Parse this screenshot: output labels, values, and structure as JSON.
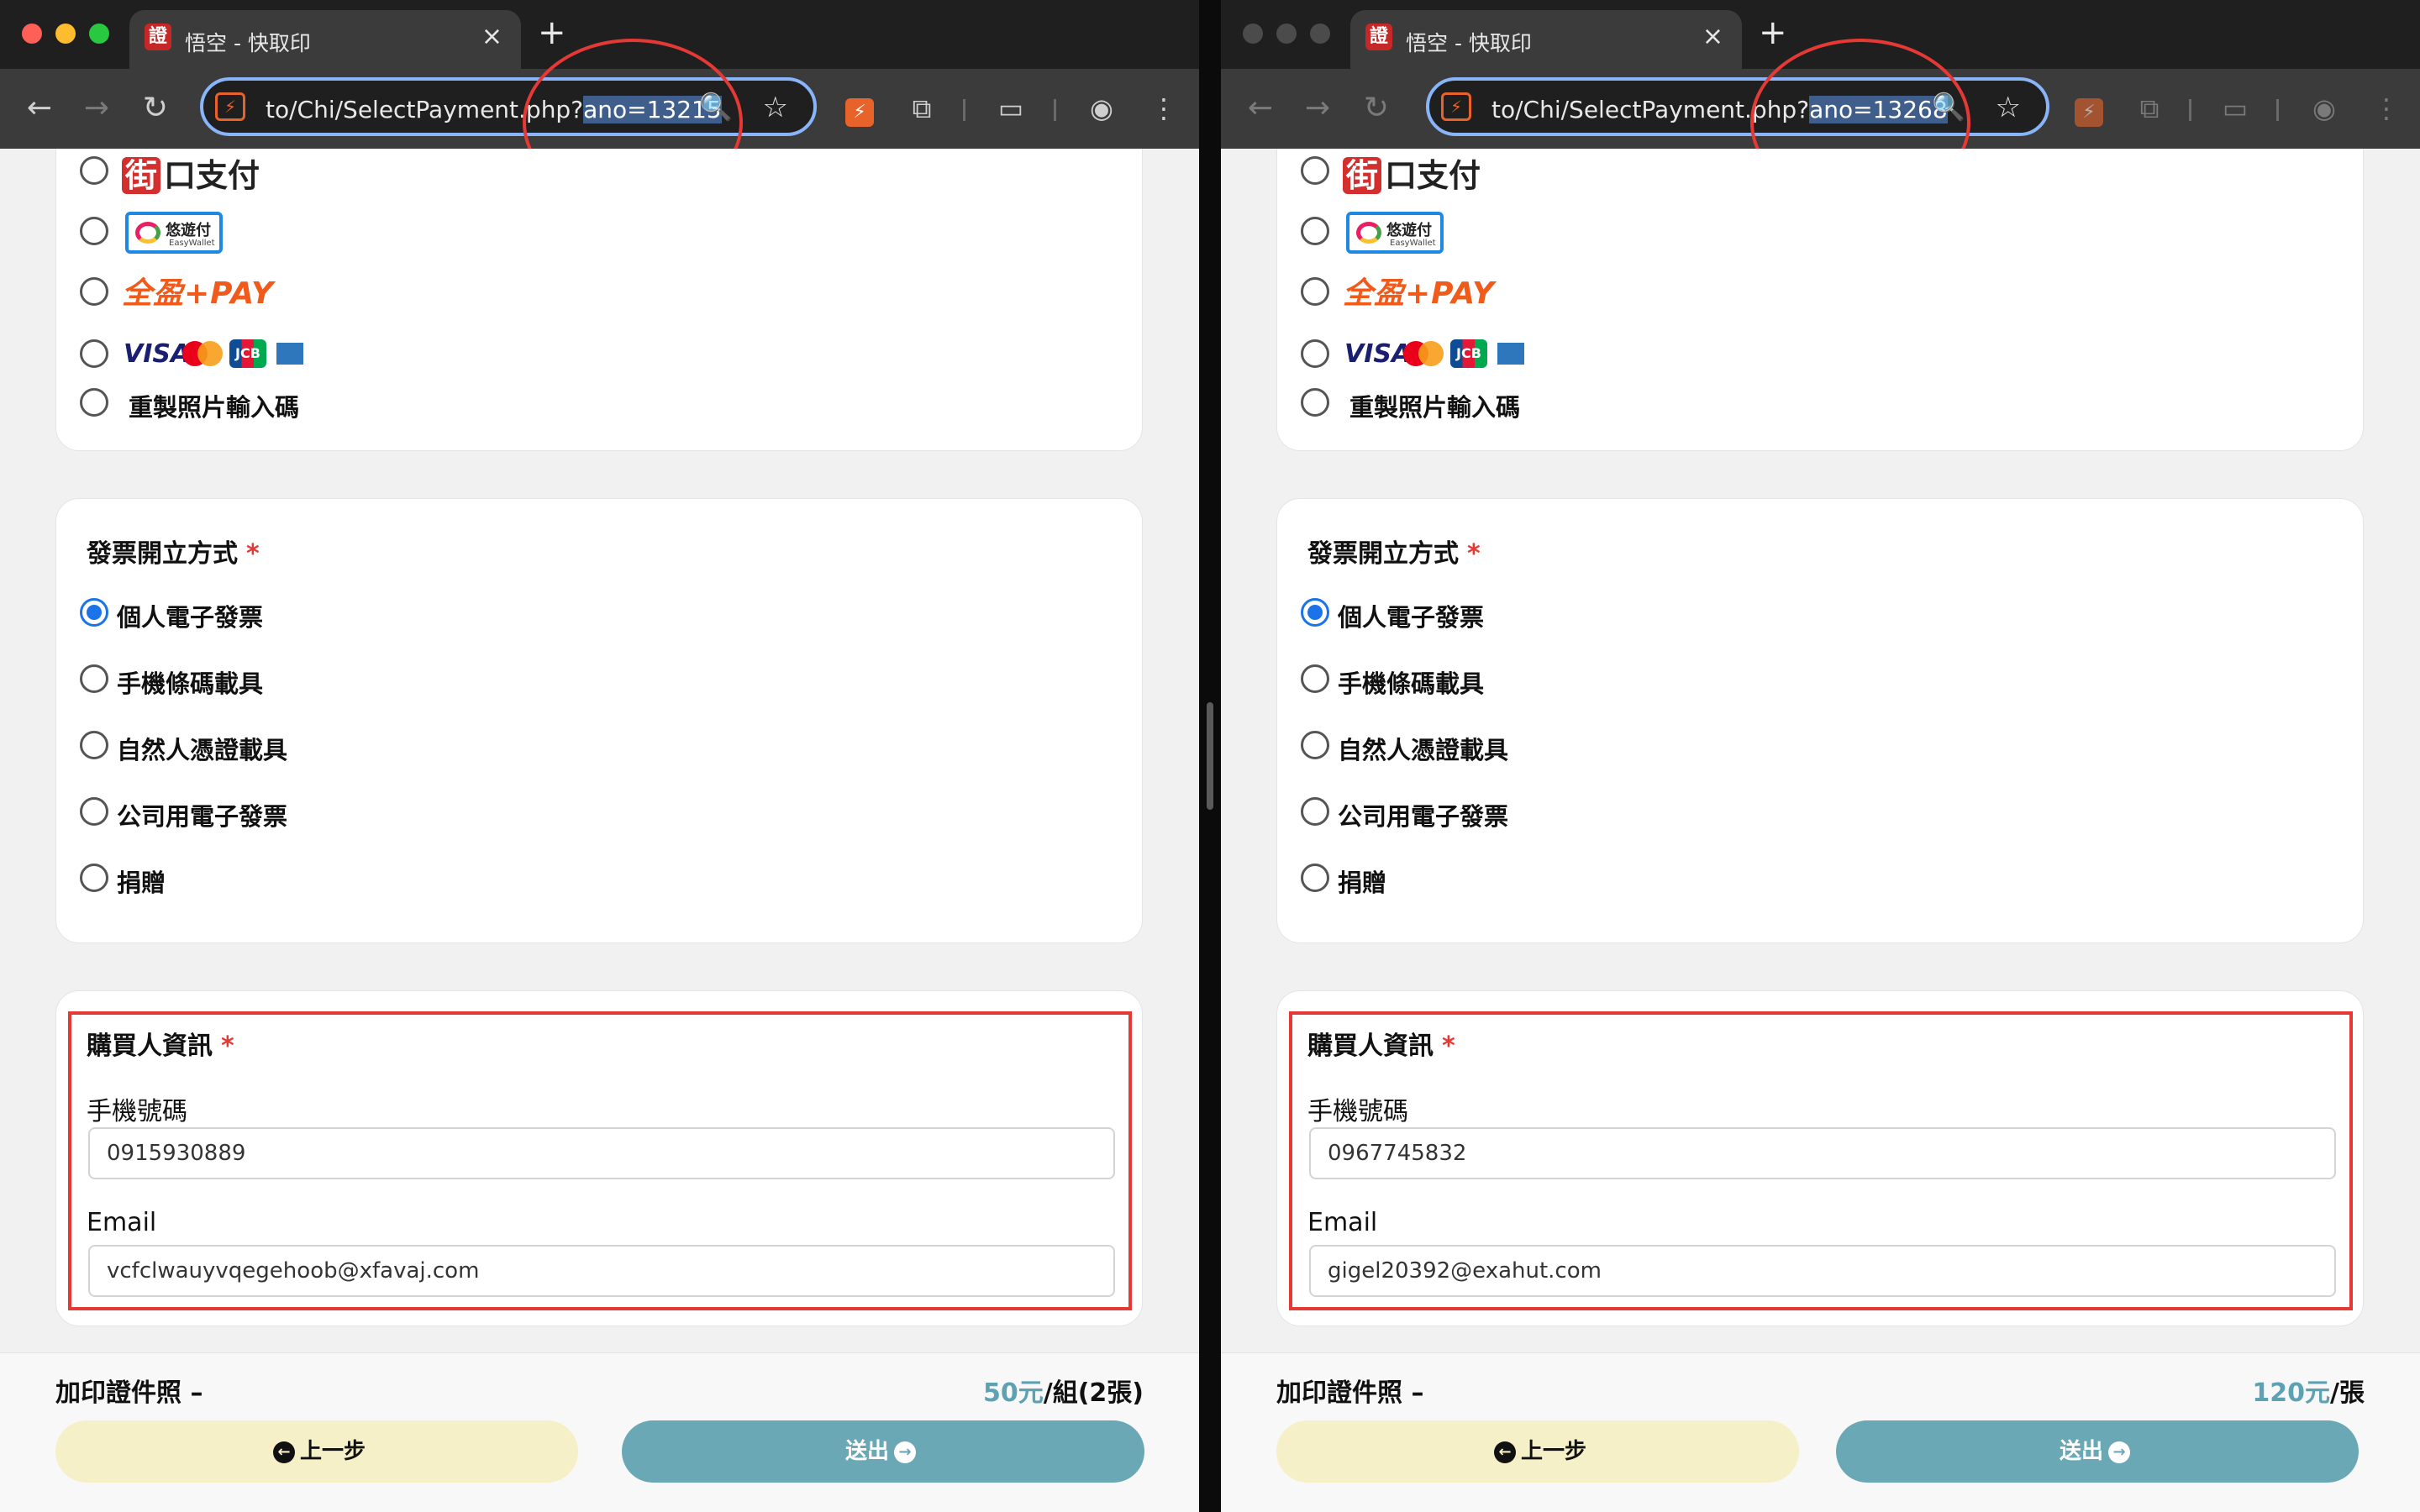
{
  "panes": [
    {
      "tab_title": "悟空 - 快取印",
      "url_prefix": "to/Chi/SelectPayment.php?",
      "url_highlight": "ano=13215",
      "payment_options": [
        "重製照片輸入碼"
      ],
      "logo_texts": {
        "jiekou_red": "街",
        "jiekou_rest": "口支付",
        "easy_top": "悠遊付",
        "easy_bottom": "EasyWallet",
        "quanying": "全盈+PAY",
        "visa": "VISA",
        "jcb": "JCB"
      },
      "invoice_title": "發票開立方式",
      "invoice_options": [
        "個人電子發票",
        "手機條碼載具",
        "自然人憑證載具",
        "公司用電子發票",
        "捐贈"
      ],
      "invoice_selected_index": 0,
      "buyer_title": "購買人資訊",
      "phone_label": "手機號碼",
      "phone_value": "0915930889",
      "email_label": "Email",
      "email_value": "vcfclwauyvqegehoob@xfavaj.com",
      "product": "加印證件照 –",
      "price_num": "50元",
      "price_unit": "/組(2張)",
      "back_label": "上一步",
      "submit_label": "送出"
    },
    {
      "tab_title": "悟空 - 快取印",
      "url_prefix": "to/Chi/SelectPayment.php?",
      "url_highlight": "ano=13268",
      "payment_options": [
        "重製照片輸入碼"
      ],
      "logo_texts": {
        "jiekou_red": "街",
        "jiekou_rest": "口支付",
        "easy_top": "悠遊付",
        "easy_bottom": "EasyWallet",
        "quanying": "全盈+PAY",
        "visa": "VISA",
        "jcb": "JCB"
      },
      "invoice_title": "發票開立方式",
      "invoice_options": [
        "個人電子發票",
        "手機條碼載具",
        "自然人憑證載具",
        "公司用電子發票",
        "捐贈"
      ],
      "invoice_selected_index": 0,
      "buyer_title": "購買人資訊",
      "phone_label": "手機號碼",
      "phone_value": "0967745832",
      "email_label": "Email",
      "email_value": "gigel20392@exahut.com",
      "product": "加印證件照 –",
      "price_num": "120元",
      "price_unit": "/張",
      "back_label": "上一步",
      "submit_label": "送出"
    }
  ],
  "icons": {
    "back": "←",
    "forward": "→",
    "reload": "↻",
    "zoom": "🔍",
    "star": "☆",
    "extension": "⚡",
    "puzzle": "⧉",
    "cast": "▭",
    "profile": "◉",
    "menu": "⋮",
    "close": "×",
    "newtab": "+",
    "prev_arrow": "←",
    "next_arrow": "→",
    "required": "*"
  },
  "colors": {
    "accent_blue": "#1a73e8",
    "annotation_red": "#e53935",
    "price_teal": "#5ca2b3",
    "submit_teal": "#6aa8b6",
    "back_yellow": "#f5f0c8"
  }
}
